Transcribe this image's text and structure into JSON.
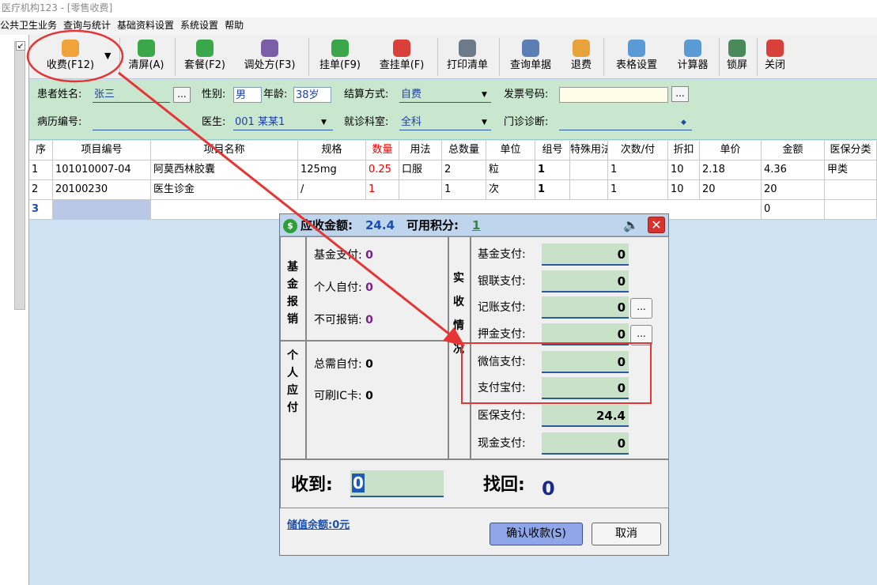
{
  "window": {
    "title": "医疗机构123 - [零售收费]"
  },
  "menu": [
    "公共卫生业务",
    "查询与统计",
    "基础资料设置",
    "系统设置",
    "帮助"
  ],
  "toolbar": [
    {
      "label": "收费(F12)",
      "color": "#f1a33b",
      "icon": "charge-icon"
    },
    {
      "label": "清屏(A)",
      "color": "#3aa84a",
      "icon": "refresh-icon"
    },
    {
      "label": "套餐(F2)",
      "color": "#3aa84a",
      "icon": "package-icon"
    },
    {
      "label": "调处方(F3)",
      "color": "#7b5ea7",
      "icon": "prescription-icon"
    },
    {
      "label": "挂单(F9)",
      "color": "#3aa84a",
      "icon": "hang-order-icon"
    },
    {
      "label": "查挂单(F)",
      "color": "#d9403a",
      "icon": "query-hang-icon"
    },
    {
      "label": "打印清单",
      "color": "#6c7a89",
      "icon": "print-icon"
    },
    {
      "label": "查询单据",
      "color": "#5b7fb5",
      "icon": "query-doc-icon"
    },
    {
      "label": "退费",
      "color": "#e8a23b",
      "icon": "refund-icon"
    },
    {
      "label": "表格设置",
      "color": "#5b9bd5",
      "icon": "table-settings-icon"
    },
    {
      "label": "计算器",
      "color": "#5b9bd5",
      "icon": "calculator-icon"
    },
    {
      "label": "锁屏",
      "color": "#4a8a5a",
      "icon": "lock-screen-icon"
    },
    {
      "label": "关闭",
      "color": "#d9403a",
      "icon": "close-app-icon"
    }
  ],
  "form": {
    "patient_name_label": "患者姓名:",
    "patient_name": "张三",
    "gender_label": "性别:",
    "gender": "男",
    "age_label": "年龄:",
    "age": "38岁",
    "settle_label": "结算方式:",
    "settle": "自费",
    "invoice_label": "发票号码:",
    "invoice": "",
    "record_label": "病历编号:",
    "record": "",
    "doctor_label": "医生:",
    "doctor": "001 某某1",
    "dept_label": "就诊科室:",
    "dept": "全科",
    "diag_label": "门诊诊断:",
    "diag": ""
  },
  "table": {
    "columns": [
      "序",
      "项目编号",
      "项目名称",
      "规格",
      "数量",
      "用法",
      "总数量",
      "单位",
      "组号",
      "特殊用法",
      "次数/付",
      "折扣",
      "单价",
      "金额",
      "医保分类"
    ],
    "rows": [
      [
        "1",
        "101010007-04",
        "阿莫西林胶囊",
        "125mg",
        "0.25",
        "口服",
        "2",
        "粒",
        "1",
        "",
        "1",
        "10",
        "2.18",
        "4.36",
        "甲类"
      ],
      [
        "2",
        "20100230",
        "医生诊金",
        "/",
        "1",
        "",
        "1",
        "次",
        "1",
        "",
        "1",
        "10",
        "20",
        "20",
        ""
      ],
      [
        "3",
        "",
        "",
        "",
        "",
        "",
        "",
        "",
        "",
        "",
        "",
        "",
        "",
        "0",
        ""
      ]
    ]
  },
  "dialog": {
    "due_label": "应收金额:",
    "due": "24.4",
    "points_label": "可用积分:",
    "points": "1",
    "fund_section": "基金报销",
    "personal_section": "个人应付",
    "actual_section": "实收情况",
    "left_items": [
      {
        "label": "基金支付:",
        "value": "0"
      },
      {
        "label": "个人自付:",
        "value": "0"
      },
      {
        "label": "不可报销:",
        "value": "0"
      }
    ],
    "personal_items": [
      {
        "label": "总需自付:",
        "value": "0"
      },
      {
        "label": "可刷IC卡:",
        "value": "0"
      }
    ],
    "payments": [
      {
        "label": "基金支付:",
        "value": "0"
      },
      {
        "label": "银联支付:",
        "value": "0"
      },
      {
        "label": "记账支付:",
        "value": "0"
      },
      {
        "label": "押金支付:",
        "value": "0"
      },
      {
        "label": "微信支付:",
        "value": "0"
      },
      {
        "label": "支付宝付:",
        "value": "0"
      },
      {
        "label": "医保支付:",
        "value": "24.4"
      },
      {
        "label": "现金支付:",
        "value": "0"
      }
    ],
    "received_label": "收到:",
    "received": "0",
    "change_label": "找回:",
    "change": "0",
    "balance": "储值余额:0元",
    "confirm": "确认收款(S)",
    "cancel": "取消",
    "more": "..."
  },
  "colors": {
    "annotation": "#e53535",
    "accent": "#1e5ab4",
    "form_bg": "#c9e6cf"
  }
}
